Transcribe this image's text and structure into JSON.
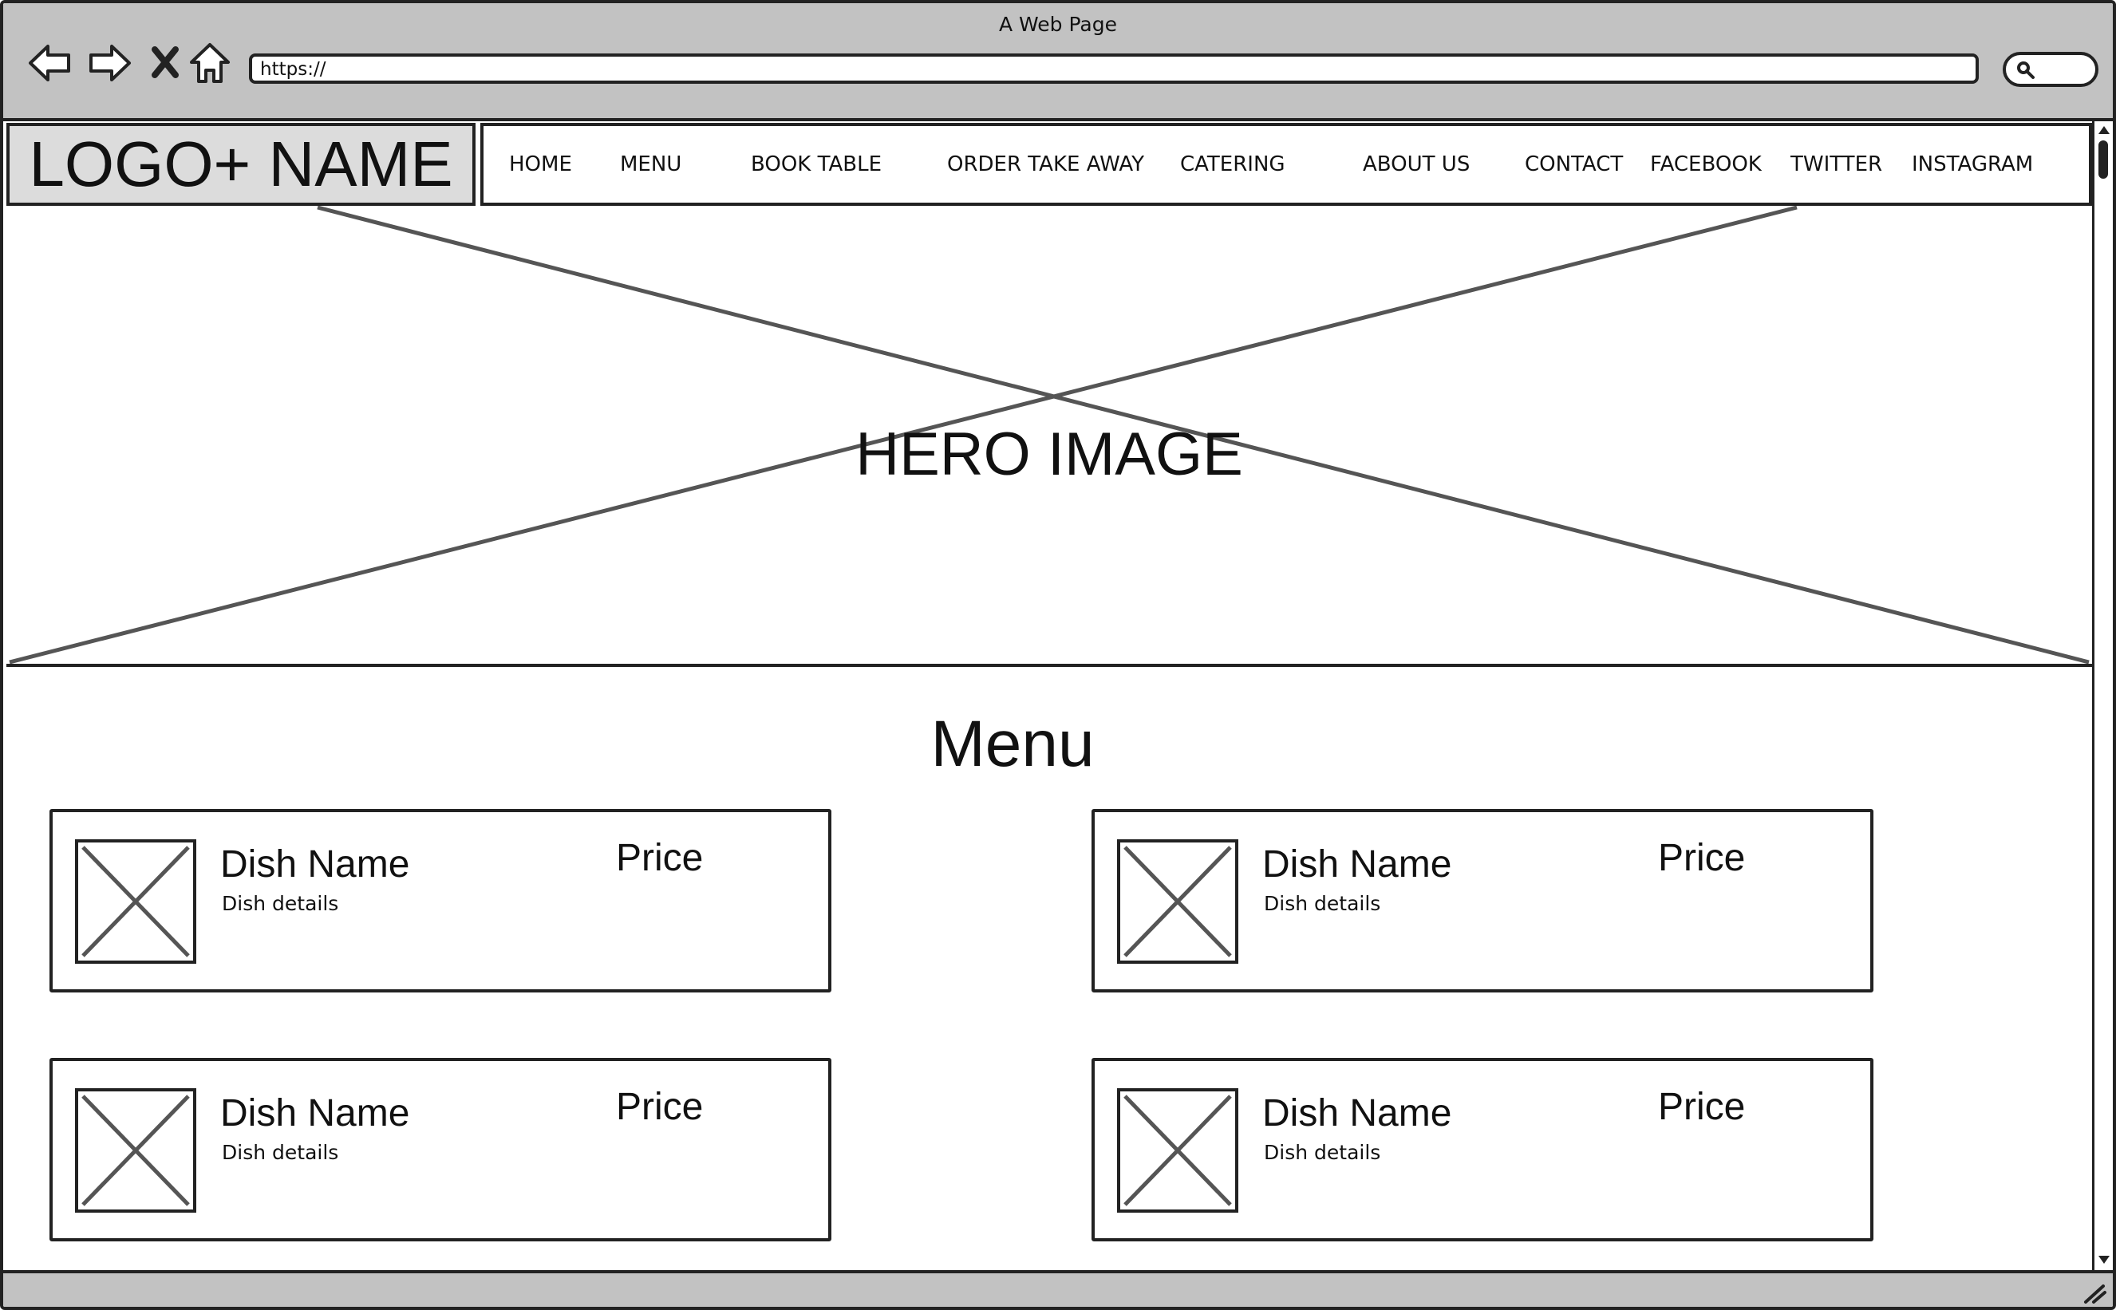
{
  "browser": {
    "window_title": "A Web Page",
    "url": "https://",
    "icons": {
      "back": "back-arrow-icon",
      "forward": "forward-arrow-icon",
      "stop": "close-icon",
      "home": "home-icon",
      "search": "search-icon"
    }
  },
  "header": {
    "logo_text": "LOGO+ NAME",
    "nav": [
      {
        "label": "HOME"
      },
      {
        "label": "MENU"
      },
      {
        "label": "BOOK TABLE"
      },
      {
        "label": "ORDER TAKE AWAY"
      },
      {
        "label": "CATERING"
      },
      {
        "label": "ABOUT US"
      },
      {
        "label": "CONTACT"
      },
      {
        "label": "FACEBOOK"
      },
      {
        "label": "TWITTER"
      },
      {
        "label": "INSTAGRAM"
      }
    ]
  },
  "hero": {
    "label": "HERO IMAGE"
  },
  "menu": {
    "title": "Menu",
    "dishes": [
      {
        "name": "Dish Name",
        "details": "Dish details",
        "price": "Price"
      },
      {
        "name": "Dish Name",
        "details": "Dish details",
        "price": "Price"
      },
      {
        "name": "Dish Name",
        "details": "Dish details",
        "price": "Price"
      },
      {
        "name": "Dish Name",
        "details": "Dish details",
        "price": "Price"
      }
    ]
  },
  "colors": {
    "chrome": "#c2c2c2",
    "logo_background": "#dcdcdc",
    "stroke": "#222222",
    "placeholder_cross": "#555555"
  }
}
